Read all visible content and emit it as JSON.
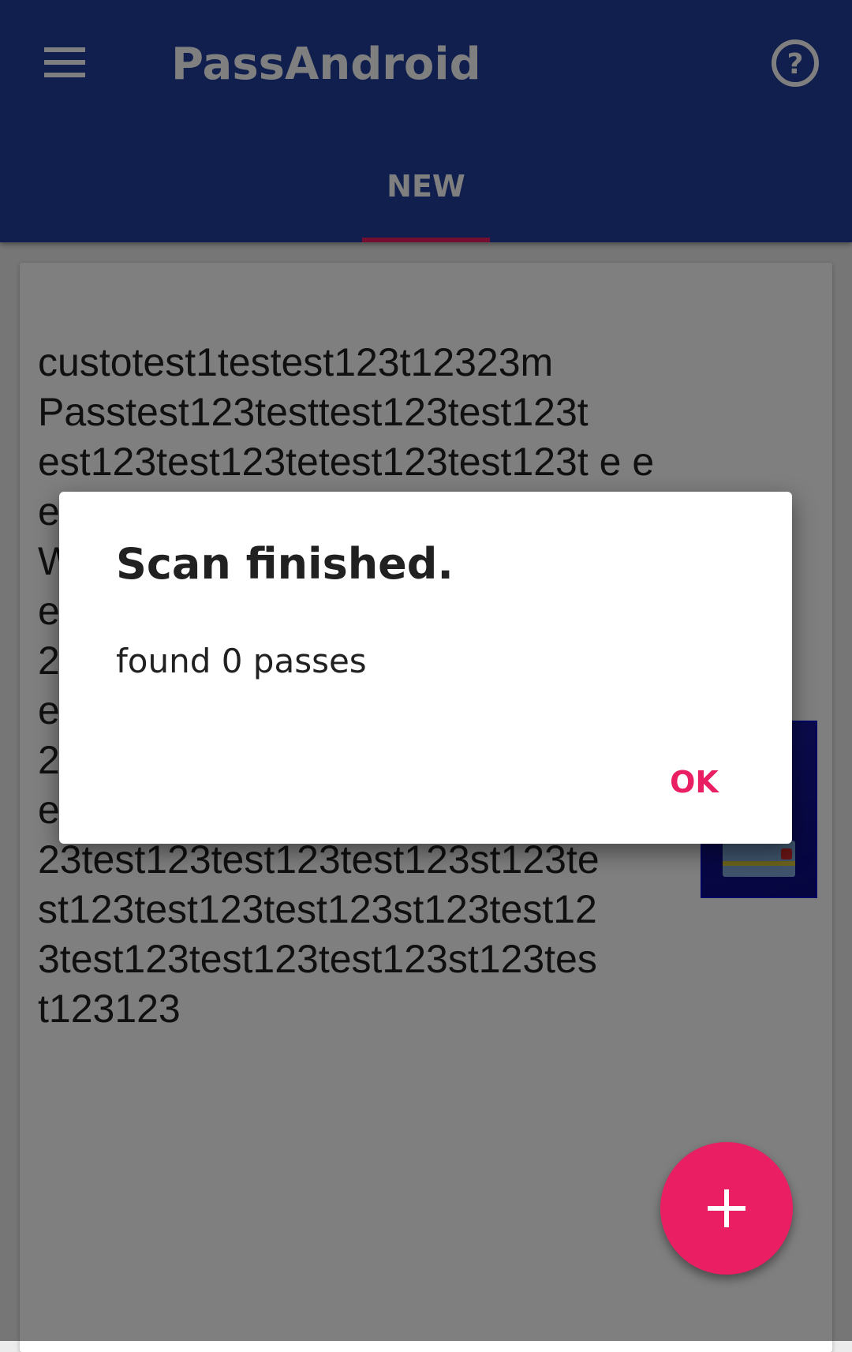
{
  "appbar": {
    "title": "PassAndroid",
    "menu_icon": "hamburger-menu-icon",
    "help_icon": "help-circle-icon",
    "tabs": [
      {
        "label": "NEW"
      }
    ]
  },
  "pass": {
    "text": "custotest1testest123t12323m Passtest123testtest123test123t est123test123tetest123test123t e e e e e e e WorldHelloWorldtest123test123t est123test123test123st123test1 23test123test123test123st123t est123test123test123st123test1 23test123test123test123st123t est123test123test123st123test1 23test123test123test123st123te st123test123test123st123test12 3test123test123test123st123tes t123123"
  },
  "dialog": {
    "title": "Scan finished.",
    "message": "found 0 passes",
    "ok_label": "OK"
  },
  "fab": {
    "icon": "plus-icon"
  },
  "colors": {
    "primary": "#213f9b",
    "accent": "#e91e63",
    "dialog_background": "#ffffff"
  }
}
